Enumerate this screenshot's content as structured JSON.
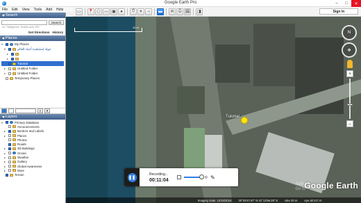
{
  "window": {
    "title": "Google Earth Pro"
  },
  "menu": [
    "File",
    "Edit",
    "View",
    "Tools",
    "Add",
    "Help"
  ],
  "toolbar": {
    "sign_in": "Sign In"
  },
  "search": {
    "header": "Search",
    "button": "Search",
    "placeholder": "ex: Categories: Hotels near JFK",
    "get_directions": "Get Directions",
    "history": "History"
  },
  "places": {
    "header": "Places",
    "items": [
      {
        "label": "My Places",
        "level": 0,
        "checked": true,
        "icon": "globe-icon"
      },
      {
        "label": "جولة لمشاهدة أحياء العالم",
        "level": 1,
        "checked": true,
        "icon": "folder-icon"
      },
      {
        "label": "",
        "level": 2,
        "checked": true,
        "icon": "folder-icon"
      },
      {
        "label": "",
        "level": 2,
        "checked": true,
        "icon": "folder-icon"
      },
      {
        "label": "Tutorial",
        "level": 1,
        "checked": true,
        "icon": "pin-icon",
        "selected": true
      },
      {
        "label": "Untitled Folder",
        "level": 1,
        "checked": false,
        "icon": "folder-icon"
      },
      {
        "label": "Untitled Folder",
        "level": 1,
        "checked": false,
        "icon": "folder-icon"
      },
      {
        "label": "Temporary Places",
        "level": 0,
        "checked": false,
        "icon": "folder-icon"
      }
    ]
  },
  "layers": {
    "header": "Layers",
    "items": [
      {
        "label": "Primary Database",
        "level": 0
      },
      {
        "label": "Announcements",
        "level": 1
      },
      {
        "label": "Borders and Labels",
        "level": 1
      },
      {
        "label": "Places",
        "level": 1
      },
      {
        "label": "Photos",
        "level": 1
      },
      {
        "label": "Roads",
        "level": 1
      },
      {
        "label": "3D Buildings",
        "level": 1
      },
      {
        "label": "Ocean",
        "level": 1
      },
      {
        "label": "Weather",
        "level": 1
      },
      {
        "label": "Gallery",
        "level": 1
      },
      {
        "label": "Global Awareness",
        "level": 1
      },
      {
        "label": "More",
        "level": 1
      },
      {
        "label": "Terrain",
        "level": 0
      }
    ]
  },
  "map": {
    "scale_label": "10 m",
    "placemark_label": "Tutorial",
    "logo": "Google Earth",
    "watermark_line1": "Activ",
    "watermark_line2": "Go to",
    "status": {
      "imagery_date": "Imagery Date: 12/10/2018",
      "coords": "30°03'47.87\" N  31°13'56.28\" E",
      "elev": "elev  20 m",
      "eye": "eye alt  217 m"
    }
  },
  "recorder": {
    "status": "Recording...",
    "time": "00:11:04"
  }
}
